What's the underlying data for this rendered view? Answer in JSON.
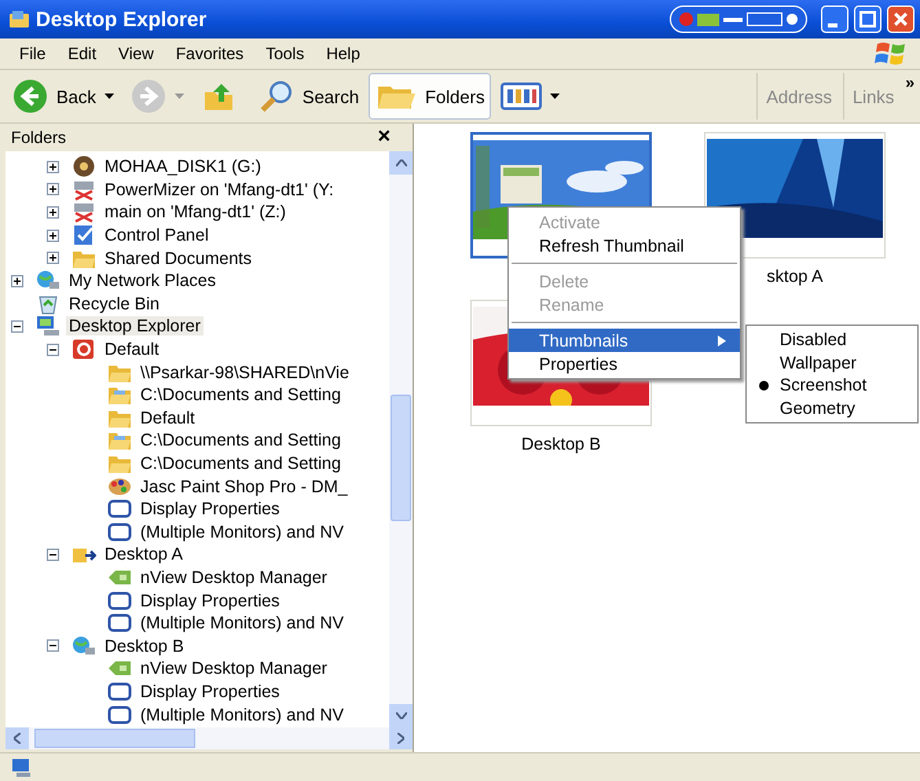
{
  "window": {
    "title": "Desktop Explorer"
  },
  "menu_bar": [
    "File",
    "Edit",
    "View",
    "Favorites",
    "Tools",
    "Help"
  ],
  "toolbar": [
    {
      "kind": "back",
      "label": "Back",
      "selected": false
    },
    {
      "kind": "forward",
      "selected": false
    },
    {
      "kind": "up",
      "selected": false
    },
    {
      "kind": "search",
      "label": "Search",
      "selected": false
    },
    {
      "kind": "folders",
      "label": "Folders",
      "selected": true
    },
    {
      "kind": "views",
      "selected": false
    },
    {
      "kind": "address",
      "label": "Address",
      "selected": false
    },
    {
      "kind": "links",
      "label": "Links",
      "selected": false
    },
    {
      "kind": "more",
      "label": "»",
      "selected": false
    }
  ],
  "folders_pane": {
    "title": "Folders",
    "close": "×",
    "continued_items": [
      {
        "label": "MOHAA_DISK1 (G:)",
        "kind": "disc",
        "expanded": false,
        "selected": false
      },
      {
        "label": "PowerMizer on 'Mfang-dt1' (Y:",
        "kind": "netdrive",
        "expanded": false,
        "selected": false
      },
      {
        "label": "main on 'Mfang-dt1' (Z:)",
        "kind": "netdrive",
        "expanded": false,
        "selected": false
      },
      {
        "label": "Control Panel",
        "kind": "control",
        "expanded": false,
        "selected": false
      },
      {
        "label": "Shared Documents",
        "kind": "folder",
        "expanded": false,
        "selected": false
      }
    ],
    "items": [
      {
        "label": "My Network Places",
        "kind": "network",
        "expanded": false,
        "selected": false
      },
      {
        "label": "Recycle Bin",
        "kind": "recycle",
        "selected": false
      },
      {
        "label": "Desktop Explorer",
        "kind": "desktops",
        "expanded": true,
        "selected": true,
        "children": [
          {
            "label": "Default",
            "kind": "app",
            "expanded": true,
            "selected": false,
            "children": [
              {
                "label": "\\\\Psarkar-98\\SHARED\\nVie",
                "kind": "folder",
                "selected": false
              },
              {
                "label": "C:\\Documents and Setting",
                "kind": "folderfile",
                "selected": false
              },
              {
                "label": "Default",
                "kind": "folder",
                "selected": false
              },
              {
                "label": "C:\\Documents and Setting",
                "kind": "folderfile",
                "selected": false
              },
              {
                "label": "C:\\Documents and Setting",
                "kind": "folder",
                "selected": false
              },
              {
                "label": "Jasc Paint Shop Pro - DM_",
                "kind": "paint",
                "selected": false
              },
              {
                "label": "Display Properties",
                "kind": "monitor",
                "selected": false
              },
              {
                "label": "(Multiple Monitors) and NV",
                "kind": "monitor",
                "selected": false
              }
            ]
          },
          {
            "label": "Desktop A",
            "kind": "folderarrow",
            "expanded": true,
            "selected": false,
            "children": [
              {
                "label": "nView Desktop Manager",
                "kind": "nview",
                "selected": false
              },
              {
                "label": "Display Properties",
                "kind": "monitor",
                "selected": false
              },
              {
                "label": "(Multiple Monitors) and NV",
                "kind": "monitor",
                "selected": false
              }
            ]
          },
          {
            "label": "Desktop B",
            "kind": "network",
            "expanded": true,
            "selected": false,
            "children": [
              {
                "label": "nView Desktop Manager",
                "kind": "nview",
                "selected": false
              },
              {
                "label": "Display Properties",
                "kind": "monitor",
                "selected": false
              },
              {
                "label": "(Multiple Monitors) and NV",
                "kind": "monitor",
                "selected": false
              }
            ]
          }
        ]
      }
    ]
  },
  "thumbnails": [
    {
      "kind": "xp",
      "selected": true
    },
    {
      "kind": "blue",
      "label": "sktop A",
      "selected": false
    },
    {
      "kind": "red",
      "label": "Desktop B",
      "selected": false
    }
  ],
  "context_menu": [
    {
      "kind": "item",
      "label": "Activate",
      "disabled": true,
      "selected": false
    },
    {
      "kind": "item",
      "label": "Refresh Thumbnail",
      "disabled": false,
      "selected": false
    },
    {
      "kind": "separator"
    },
    {
      "kind": "item",
      "label": "Delete",
      "disabled": true,
      "selected": false
    },
    {
      "kind": "item",
      "label": "Rename",
      "disabled": true,
      "selected": false
    },
    {
      "kind": "separator"
    },
    {
      "kind": "submenu",
      "label": "Thumbnails",
      "disabled": false,
      "selected": true
    },
    {
      "kind": "item",
      "label": "Properties",
      "disabled": false,
      "selected": false
    }
  ],
  "submenu": [
    {
      "label": "Disabled",
      "checked": false
    },
    {
      "label": "Wallpaper",
      "checked": false
    },
    {
      "label": "Screenshot",
      "checked": true
    },
    {
      "label": "Geometry",
      "checked": false
    }
  ]
}
